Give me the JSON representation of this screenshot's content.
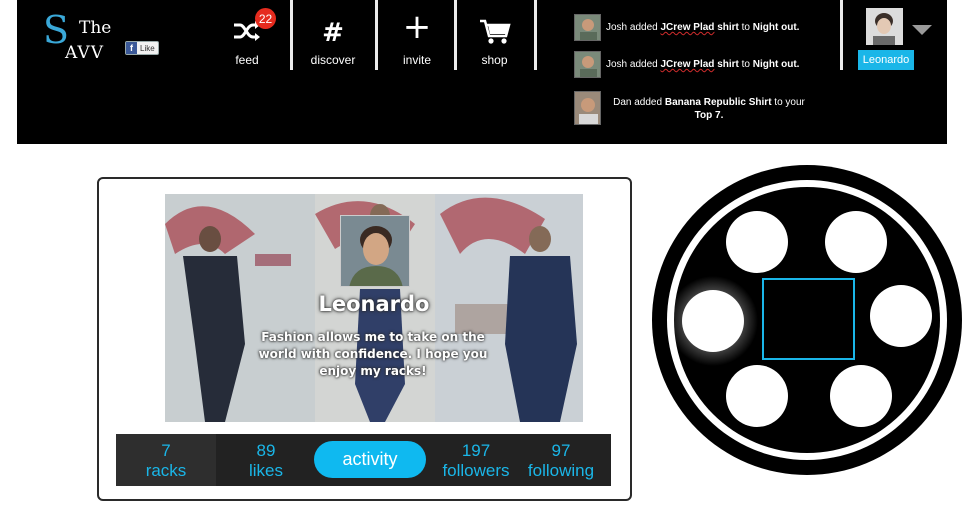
{
  "logo": {
    "big_letter": "S",
    "the": "The",
    "avv": "AVV"
  },
  "fb_like": {
    "icon": "f",
    "label": "Like"
  },
  "nav": {
    "feed_label": "feed",
    "feed_badge": "22",
    "discover_label": "discover",
    "discover_glyph": "#",
    "invite_label": "invite",
    "invite_glyph": "+",
    "shop_label": "shop"
  },
  "activity": [
    {
      "user": "Josh",
      "verb": " added ",
      "item": "JCrew Plad",
      "item_suffix": " shirt",
      "mid": " to ",
      "target": "Night out."
    },
    {
      "user": "Josh",
      "verb": " added ",
      "item": "JCrew Plad",
      "item_suffix": " shirt",
      "mid": " to ",
      "target": "Night out."
    },
    {
      "user": "Dan",
      "verb": " added ",
      "item": "Banana Republic Shirt",
      "mid": " to your ",
      "target": "Top 7."
    }
  ],
  "user": {
    "name": "Leonardo"
  },
  "profile": {
    "name": "Leonardo",
    "bio": "Fashion allows me to take on the world with confidence. I hope you enjoy my racks!"
  },
  "stats": {
    "racks_num": "7",
    "racks_label": "racks",
    "likes_num": "89",
    "likes_label": "likes",
    "activity_label": "activity",
    "followers_num": "197",
    "followers_label": "followers",
    "following_num": "97",
    "following_label": "following"
  },
  "colors": {
    "accent": "#1ab6e8",
    "badge": "#e52b1e",
    "topbar": "#000000"
  },
  "icons": [
    "shuffle-icon",
    "hash-icon",
    "plus-icon",
    "cart-icon",
    "facebook-icon",
    "chevron-down-icon"
  ]
}
